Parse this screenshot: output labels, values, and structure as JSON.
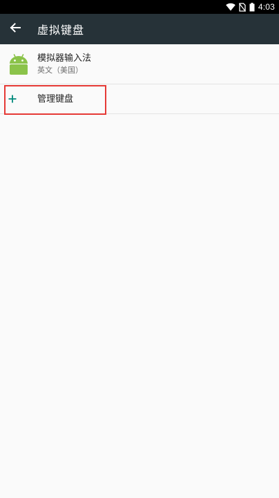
{
  "status_bar": {
    "time": "4:03",
    "icons": [
      "wifi-icon",
      "no-sim-icon",
      "battery-icon"
    ]
  },
  "toolbar": {
    "back_icon": "arrow-back-icon",
    "title": "虚拟键盘"
  },
  "list": {
    "items": [
      {
        "icon": "android-icon",
        "title": "模拟器输入法",
        "subtitle": "英文（美国）"
      },
      {
        "icon": "plus-icon",
        "title": "管理键盘"
      }
    ]
  },
  "colors": {
    "toolbar_bg": "#263238",
    "android_green": "#8bc34a",
    "plus_teal": "#00897b",
    "highlight_red": "#e53935"
  }
}
